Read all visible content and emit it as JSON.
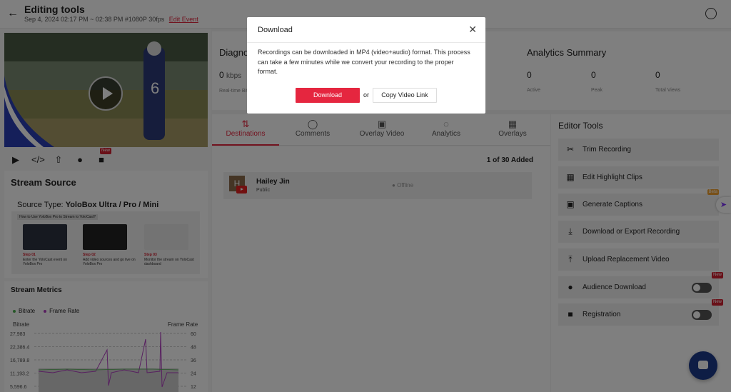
{
  "header": {
    "title": "Editing tools",
    "subtitle": "Sep 4, 2024 02:17 PM ~ 02:38 PM #1080P 30fps",
    "edit_link": "Edit Event"
  },
  "video_tools": {
    "new_badge": "New"
  },
  "stream_source": {
    "title": "Stream Source",
    "source_type_label": "Source Type:",
    "source_type_value": "YoloBox Ultra / Pro / Mini",
    "guide_header": "How to Use YoloBox Pro to Stream to YoloCast?",
    "steps": [
      {
        "label": "Step 01",
        "desc": "Enter the YoloCast event on YoloBox Pro"
      },
      {
        "label": "Step 02",
        "desc": "Add video sources and go live on YoloBox Pro"
      },
      {
        "label": "Step 03",
        "desc": "Monitor the stream on YoloCast dashboard"
      }
    ]
  },
  "stream_metrics": {
    "title": "Stream Metrics",
    "legend": [
      "Bitrate",
      "Frame Rate"
    ],
    "left_axis_label": "Bitrate",
    "right_axis_label": "Frame Rate",
    "left_ticks": [
      "27,983",
      "22,386.4",
      "16,789.8",
      "11,193.2",
      "5,596.6"
    ],
    "right_ticks": [
      "60",
      "48",
      "36",
      "24",
      "12"
    ],
    "colors": {
      "bitrate": "#4caf50",
      "frame_rate": "#b040c0"
    }
  },
  "diagnostics": {
    "title": "Diagnostics",
    "value": "0",
    "unit": "kbps",
    "label": "Real-time Bitrate"
  },
  "analytics": {
    "title": "Analytics Summary",
    "items": [
      {
        "value": "0",
        "label": "Active"
      },
      {
        "value": "0",
        "label": "Peak"
      },
      {
        "value": "0",
        "label": "Total Views"
      }
    ]
  },
  "tabs": [
    {
      "label": "Destinations",
      "icon": "destinations-icon"
    },
    {
      "label": "Comments",
      "icon": "comments-icon"
    },
    {
      "label": "Overlay Video",
      "icon": "video-icon"
    },
    {
      "label": "Analytics",
      "icon": "analytics-icon"
    },
    {
      "label": "Overlays",
      "icon": "overlays-icon"
    }
  ],
  "destinations": {
    "added": "1 of 30 Added",
    "items": [
      {
        "avatar": "H",
        "name": "Hailey Jin",
        "privacy": "Public",
        "status": "Offline"
      }
    ]
  },
  "editor_tools": {
    "title": "Editor Tools",
    "items": [
      {
        "label": "Trim Recording",
        "icon": "scissors-icon"
      },
      {
        "label": "Edit Highlight Clips",
        "icon": "clips-icon"
      },
      {
        "label": "Generate Captions",
        "icon": "captions-icon",
        "badge": "Beta"
      },
      {
        "label": "Download or Export Recording",
        "icon": "download-icon"
      },
      {
        "label": "Upload Replacement Video",
        "icon": "upload-icon"
      },
      {
        "label": "Audience Download",
        "icon": "user-download-icon",
        "badge": "New",
        "toggle": false
      },
      {
        "label": "Registration",
        "icon": "registration-icon",
        "badge": "New",
        "toggle": false
      }
    ]
  },
  "modal": {
    "title": "Download",
    "body": "Recordings can be downloaded in MP4 (video+audio) format. This process can take a few minutes while we convert your recording to the proper format.",
    "download_label": "Download",
    "or_label": "or",
    "copy_label": "Copy Video Link"
  }
}
